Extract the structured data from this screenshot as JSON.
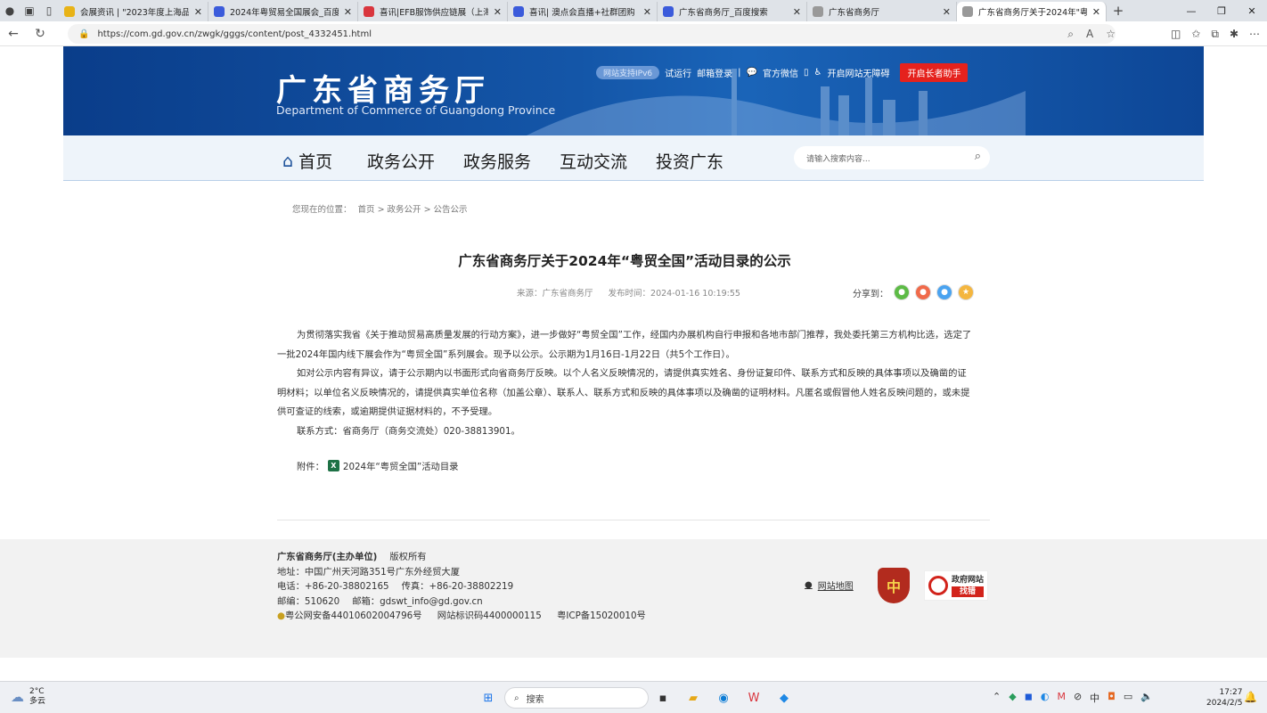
{
  "browser": {
    "tabs": [
      {
        "title": "会展资讯 | \"2023年度上海品牌",
        "color": "#e8b317"
      },
      {
        "title": "2024年粤贸易全国展会_百度搜",
        "color": "#3b5bdb"
      },
      {
        "title": "喜讯|EFB服饰供应链展（上海）",
        "color": "#d9363e"
      },
      {
        "title": "喜讯| 澳点会直播+社群团购",
        "color": "#3b5bdb"
      },
      {
        "title": "广东省商务厅_百度搜索",
        "color": "#3b5bdb"
      },
      {
        "title": "广东省商务厅",
        "color": "#999999"
      },
      {
        "title": "广东省商务厅关于2024年\"粤贸",
        "color": "#999999"
      }
    ],
    "url": "https://com.gd.gov.cn/zwgk/gggs/content/post_4332451.html"
  },
  "header": {
    "logo_cn": "广东省商务厅",
    "logo_en": "Department of Commerce of Guangdong Province",
    "ipv6": "网站支持IPv6",
    "trial": "试运行",
    "mail_login": "邮箱登录",
    "wechat": "官方微信",
    "accessible": "开启网站无障碍",
    "elder": "开启长者助手"
  },
  "nav": {
    "items": [
      "首页",
      "政务公开",
      "政务服务",
      "互动交流",
      "投资广东"
    ],
    "search_placeholder": "请输入搜索内容..."
  },
  "breadcrumb": {
    "prefix": "您现在的位置：",
    "path": "首页 > 政务公开 > 公告公示"
  },
  "article": {
    "title": "广东省商务厅关于2024年“粤贸全国”活动目录的公示",
    "source": "来源：广东省商务厅",
    "date": "发布时间：2024-01-16 10:19:55",
    "share_label": "分享到：",
    "paragraphs": [
      "为贯彻落实我省《关于推动贸易高质量发展的行动方案》，进一步做好“粤贸全国”工作，经国内办展机构自行申报和各地市部门推荐，我处委托第三方机构比选，选定了一批2024年国内线下展会作为“粤贸全国”系列展会。现予以公示。公示期为1月16日-1月22日（共5个工作日）。",
      "如对公示内容有异议，请于公示期内以书面形式向省商务厅反映。以个人名义反映情况的，请提供真实姓名、身份证复印件、联系方式和反映的具体事项以及确凿的证明材料；以单位名义反映情况的，请提供真实单位名称（加盖公章）、联系人、联系方式和反映的具体事项以及确凿的证明材料。凡匿名或假冒他人姓名反映问题的，或未提供可查证的线索，或逾期提供证据材料的，不予受理。",
      "联系方式：省商务厅（商务交流处）020-38813901。"
    ],
    "attach_label": "附件：",
    "attach_name": "2024年“粤贸全国”活动目录"
  },
  "footer": {
    "host": "广东省商务厅(主办单位)",
    "copyright": "版权所有",
    "address": "地址：中国广州天河路351号广东外经贸大厦",
    "phone": "电话：+86-20-38802165",
    "fax": "传真：+86-20-38802219",
    "postcode": "邮编：510620",
    "email": "邮箱：gdswt_info@gd.gov.cn",
    "police": "粤公网安备44010602004796号",
    "site_id": "网站标识码4400000115",
    "icp": "粤ICP备15020010号",
    "sitemap": "网站地图",
    "badge_party": "中",
    "badge_gov_top": "政府网站",
    "badge_gov_bottom": "找错"
  },
  "taskbar": {
    "temp": "2°C",
    "weather": "多云",
    "search": "搜索",
    "time": "17:27",
    "date": "2024/2/5"
  }
}
